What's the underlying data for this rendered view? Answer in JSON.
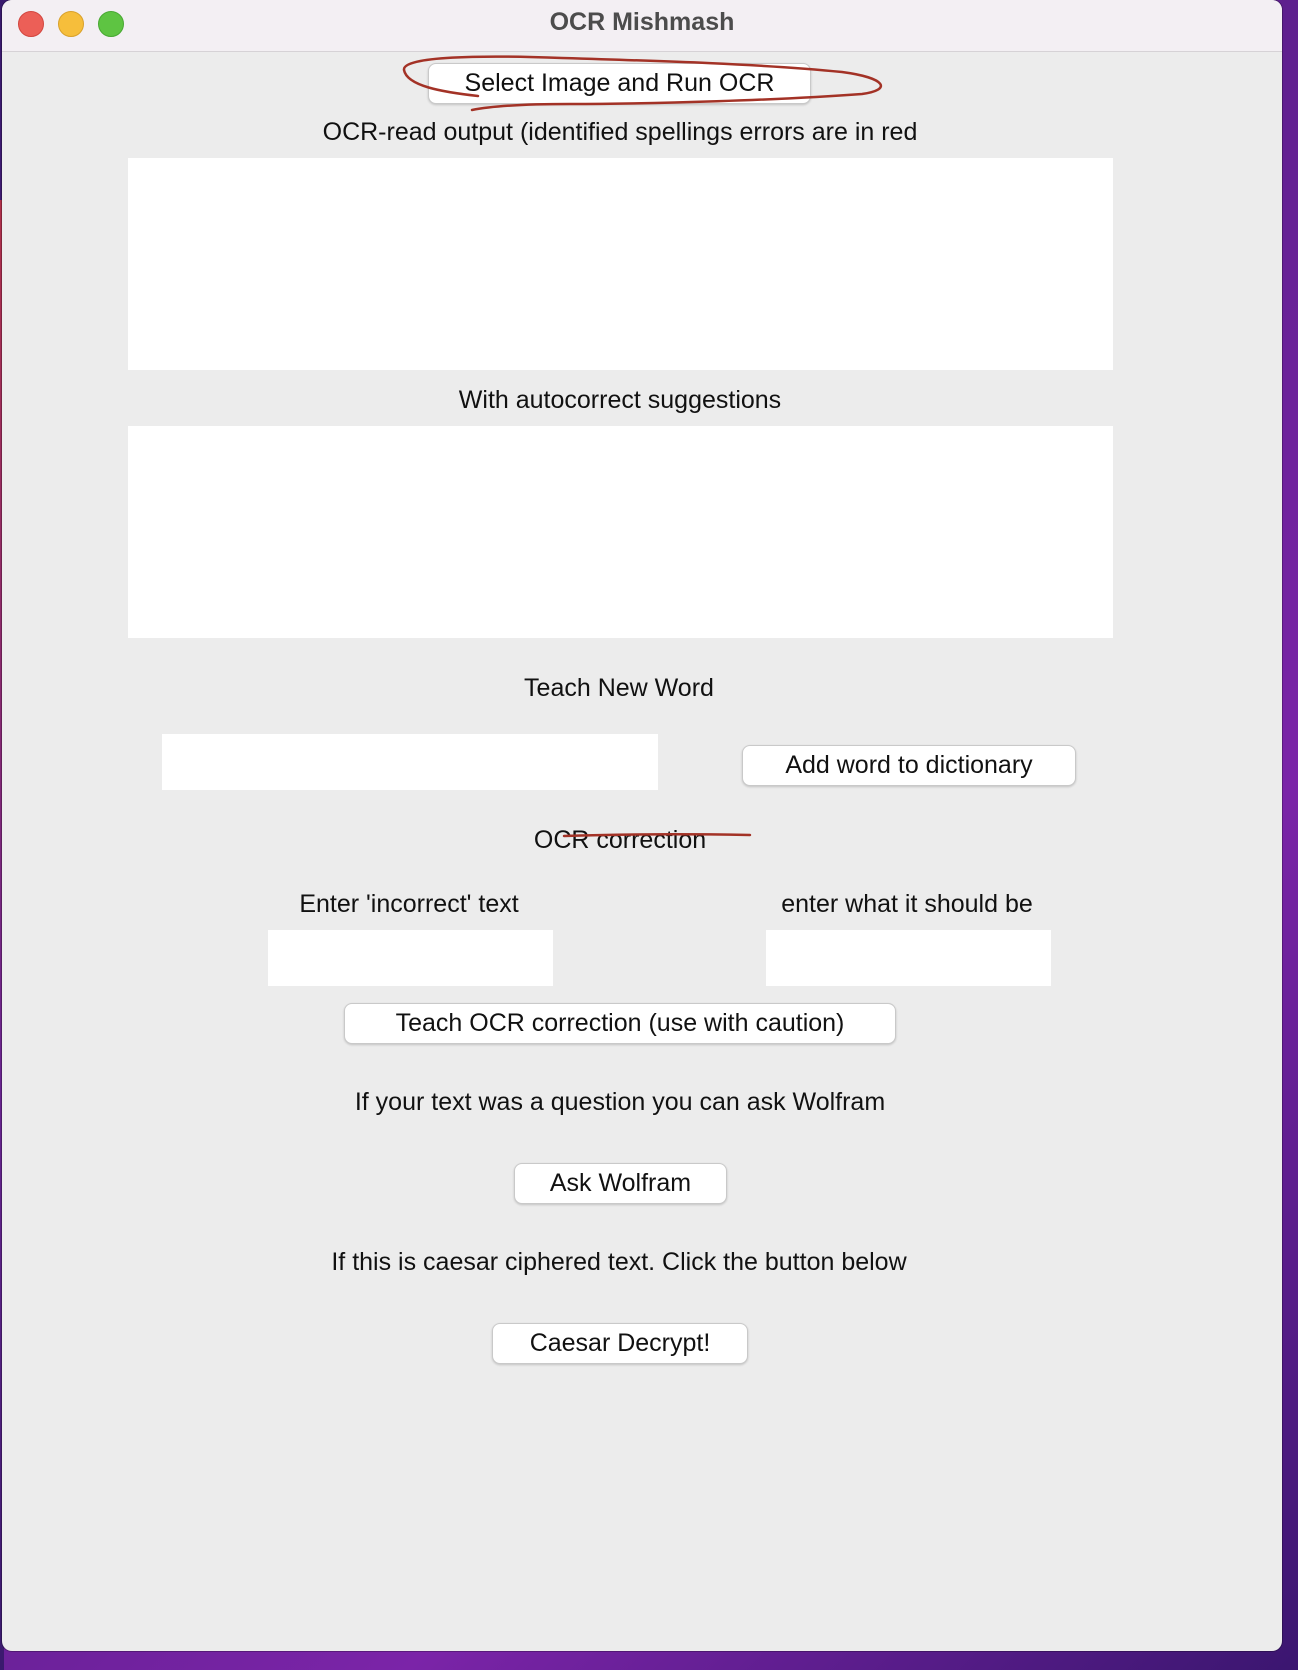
{
  "window": {
    "title": "OCR Mishmash"
  },
  "buttons": {
    "select_run_ocr": "Select Image and Run OCR",
    "add_word": "Add word to dictionary",
    "teach_ocr": "Teach OCR correction (use with caution)",
    "ask_wolfram": "Ask Wolfram",
    "caesar": "Caesar Decrypt!"
  },
  "labels": {
    "ocr_output": "OCR-read output (identified spellings errors are in red",
    "autocorrect": "With autocorrect suggestions",
    "teach_word": "Teach New Word",
    "ocr_correction": "OCR correction",
    "incorrect": "Enter 'incorrect' text",
    "should_be": "enter what it should be",
    "wolfram_prompt": "If your text was a question you can ask Wolfram",
    "caesar_prompt": "If this is caesar ciphered text. Click the button below"
  },
  "inputs": {
    "ocr_output_text": "",
    "autocorrect_text": "",
    "new_word": "",
    "incorrect_text": "",
    "correct_text": ""
  },
  "colors": {
    "annotation": "#a33226"
  }
}
